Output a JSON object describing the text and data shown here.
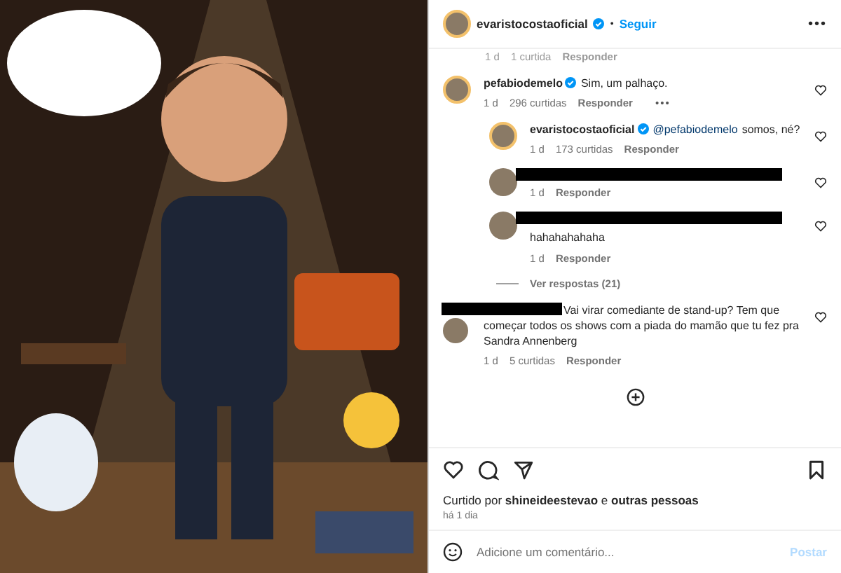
{
  "header": {
    "username": "evaristocostaoficial",
    "verified": true,
    "separator": "•",
    "follow": "Seguir",
    "more": "•••"
  },
  "top_meta": [
    "1 d",
    "1 curtida",
    "Responder"
  ],
  "comments": [
    {
      "kind": "comment",
      "username": "pefabiodemelo",
      "verified": true,
      "text": "Sim, um palhaço.",
      "meta": [
        "1 d",
        "296 curtidas",
        "Responder"
      ],
      "more": "•••"
    },
    {
      "kind": "reply",
      "username": "evaristocostaoficial",
      "verified": true,
      "mention": "@pefabiodemelo",
      "text": "somos, né?",
      "meta": [
        "1 d",
        "173 curtidas",
        "Responder"
      ]
    },
    {
      "kind": "reply",
      "redacted": true,
      "meta": [
        "1 d",
        "Responder"
      ]
    },
    {
      "kind": "reply",
      "redacted": true,
      "text": "hahahahahaha",
      "meta": [
        "1 d",
        "Responder"
      ],
      "view_replies": "Ver respostas (21)"
    },
    {
      "kind": "comment",
      "redacted": true,
      "text": "Vai virar comediante de stand-up? Tem que começar todos os shows com a piada do mamão que tu fez pra Sandra Annenberg",
      "meta": [
        "1 d",
        "5 curtidas",
        "Responder"
      ]
    }
  ],
  "actions": {
    "liked_by": "Curtido por **shineideestevao** e **outras pessoas**",
    "time": "há 1 dia"
  },
  "comment_field": {
    "placeholder": "Adicione um comentário...",
    "post": "Postar",
    "disabled": true
  }
}
